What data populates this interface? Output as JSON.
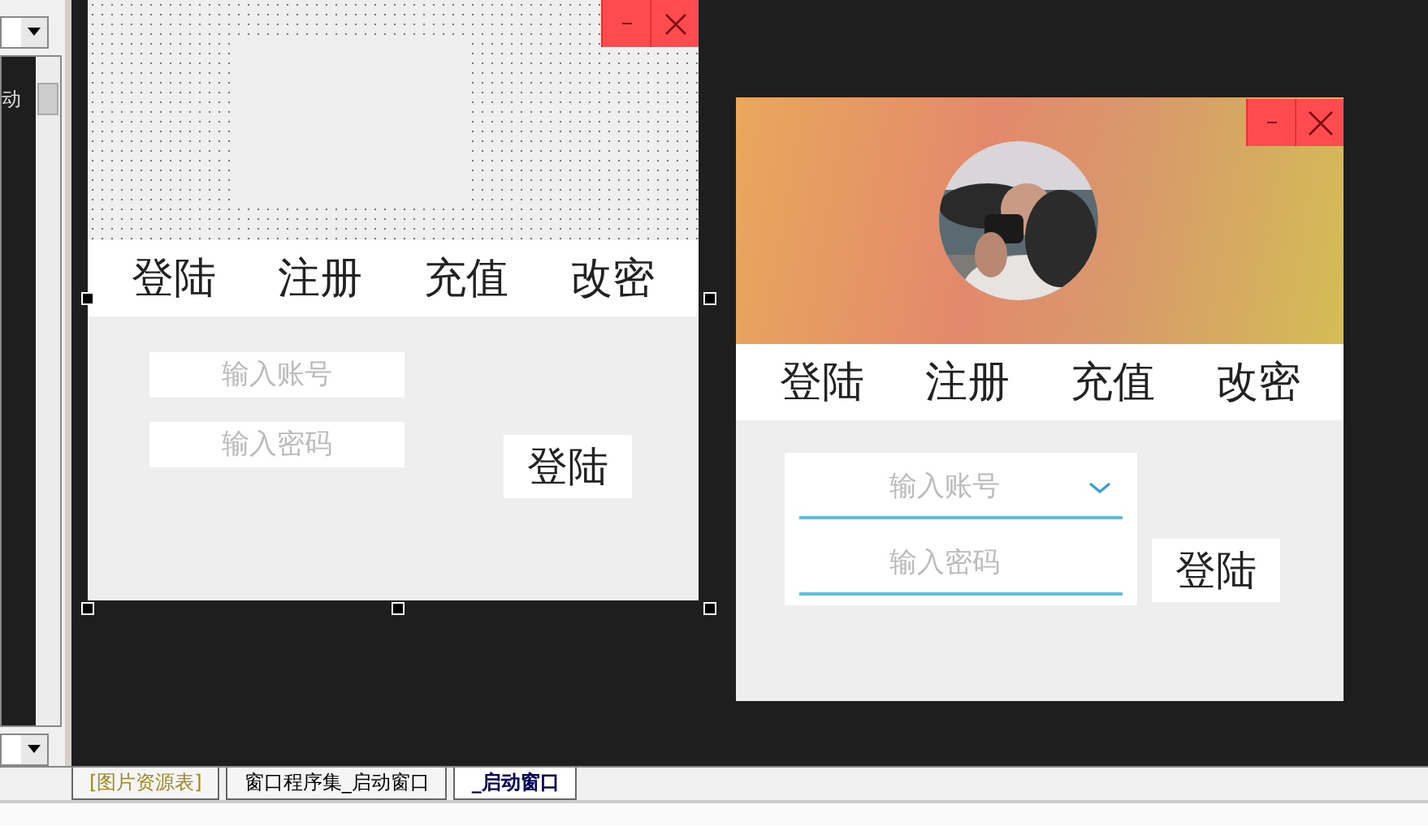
{
  "side_panel": {
    "list_item": "动"
  },
  "design_window": {
    "tabs": [
      "登陆",
      "注册",
      "充值",
      "改密"
    ],
    "fields": [
      {
        "placeholder": "输入账号"
      },
      {
        "placeholder": "输入密码"
      }
    ],
    "button": "登陆"
  },
  "preview_window": {
    "tabs": [
      "登陆",
      "注册",
      "充值",
      "改密"
    ],
    "fields": [
      {
        "placeholder": "输入账号",
        "kind": "dropdown"
      },
      {
        "placeholder": "输入密码",
        "kind": "text"
      }
    ],
    "button": "登陆"
  },
  "editor_tabs": [
    {
      "label": "[图片资源表]",
      "selected": false,
      "kind": "resource"
    },
    {
      "label": "窗口程序集_启动窗口",
      "selected": false,
      "kind": "code"
    },
    {
      "label": "_启动窗口",
      "selected": true,
      "kind": "code"
    }
  ]
}
